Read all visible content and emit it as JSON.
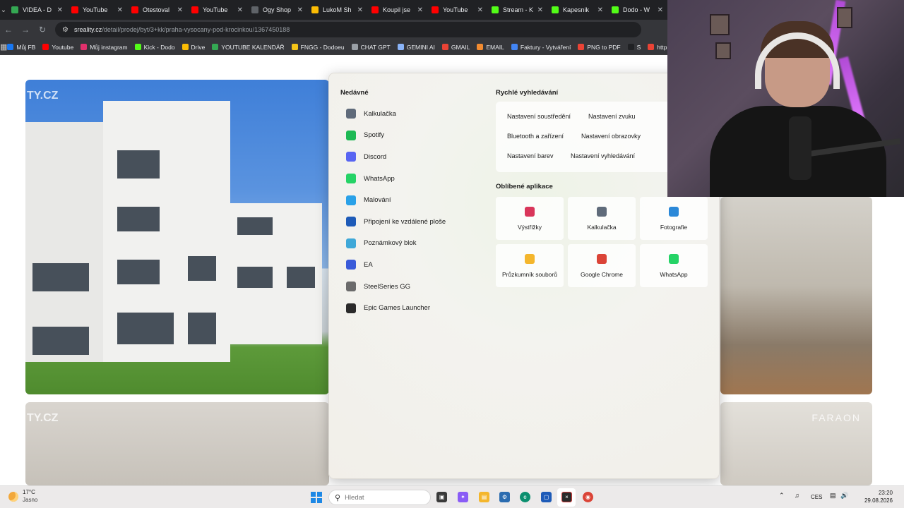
{
  "tabs": [
    {
      "label": "VIDEA - D",
      "color": "#34a853",
      "active": false
    },
    {
      "label": "YouTube",
      "color": "#ff0000",
      "active": false
    },
    {
      "label": "Otestoval",
      "color": "#ff0000",
      "active": false
    },
    {
      "label": "YouTube",
      "color": "#ff0000",
      "active": false
    },
    {
      "label": "Ogy Shop",
      "color": "#5f6368",
      "active": false
    },
    {
      "label": "LukoM Sh",
      "color": "#fbbc04",
      "active": false
    },
    {
      "label": "Koupil jse",
      "color": "#ff0000",
      "active": false
    },
    {
      "label": "YouTube",
      "color": "#ff0000",
      "active": false
    },
    {
      "label": "Stream - K",
      "color": "#53fc18",
      "active": false
    },
    {
      "label": "Kapesnik",
      "color": "#53fc18",
      "active": false
    },
    {
      "label": "Dodo - W",
      "color": "#53fc18",
      "active": false
    }
  ],
  "address": {
    "host": "sreality.cz",
    "path": "/detail/prodej/byt/3+kk/praha-vysocany-pod-krocinkou/1367450188"
  },
  "bookmarks": [
    {
      "label": "Můj FB",
      "color": "#1877f2"
    },
    {
      "label": "Youtube",
      "color": "#ff0000"
    },
    {
      "label": "Můj instagram",
      "color": "#e1306c"
    },
    {
      "label": "Kick - Dodo",
      "color": "#53fc18"
    },
    {
      "label": "Drive",
      "color": "#fbbc04"
    },
    {
      "label": "YOUTUBE KALENDÁŘ",
      "color": "#34a853"
    },
    {
      "label": "FNGG - Dodoeu",
      "color": "#f5c518"
    },
    {
      "label": "CHAT GPT",
      "color": "#9aa0a6"
    },
    {
      "label": "GEMINI AI",
      "color": "#8ab4f8"
    },
    {
      "label": "GMAIL",
      "color": "#ea4335"
    },
    {
      "label": "EMAIL",
      "color": "#f28b30"
    },
    {
      "label": "Faktury - Vytváření",
      "color": "#4285f4"
    },
    {
      "label": "PNG to PDF",
      "color": "#ea4335"
    },
    {
      "label": "S",
      "color": "#202124"
    },
    {
      "label": "http",
      "color": "#ea4335"
    }
  ],
  "start_menu": {
    "recent_title": "Nedávné",
    "recent": [
      {
        "label": "Kalkulačka",
        "icon": "calculator-icon",
        "color": "#5f6b7a"
      },
      {
        "label": "Spotify",
        "icon": "spotify-icon",
        "color": "#1db954"
      },
      {
        "label": "Discord",
        "icon": "discord-icon",
        "color": "#5865f2"
      },
      {
        "label": "WhatsApp",
        "icon": "whatsapp-icon",
        "color": "#25d366"
      },
      {
        "label": "Malování",
        "icon": "paint-icon",
        "color": "#2aa1e8"
      },
      {
        "label": "Připojení ke vzdálené ploše",
        "icon": "remote-desktop-icon",
        "color": "#1e5bb8"
      },
      {
        "label": "Poznámkový blok",
        "icon": "notepad-icon",
        "color": "#3fa8d8"
      },
      {
        "label": "EA",
        "icon": "ea-icon",
        "color": "#3a5bd9"
      },
      {
        "label": "SteelSeries GG",
        "icon": "steelseries-icon",
        "color": "#6b6b6b"
      },
      {
        "label": "Epic Games Launcher",
        "icon": "epic-games-icon",
        "color": "#2a2a2a"
      }
    ],
    "quick_title": "Rychlé vyhledávání",
    "quick_chips": [
      "Nastavení soustředění",
      "Nastavení zvuku",
      "Bluetooth a zařízení",
      "Nastavení obrazovky",
      "Nastavení barev",
      "Nastavení vyhledávání"
    ],
    "favorites_title": "Oblíbené aplikace",
    "favorites": [
      {
        "label": "Výstřižky",
        "icon": "snipping-tool-icon",
        "color": "#d9365a"
      },
      {
        "label": "Kalkulačka",
        "icon": "calculator-icon",
        "color": "#5f6b7a"
      },
      {
        "label": "Fotografie",
        "icon": "photos-icon",
        "color": "#2b88d8"
      },
      {
        "label": "Průzkumník souborů",
        "icon": "file-explorer-icon",
        "color": "#f4b62c"
      },
      {
        "label": "Google Chrome",
        "icon": "chrome-icon",
        "color": "#db4437"
      },
      {
        "label": "WhatsApp",
        "icon": "whatsapp-icon",
        "color": "#25d366"
      }
    ]
  },
  "taskbar": {
    "weather_temp": "17°C",
    "weather_cond": "Jasno",
    "search_placeholder": "Hledat",
    "lang": "CES",
    "time": "23:20",
    "date": "29.08.2026"
  }
}
